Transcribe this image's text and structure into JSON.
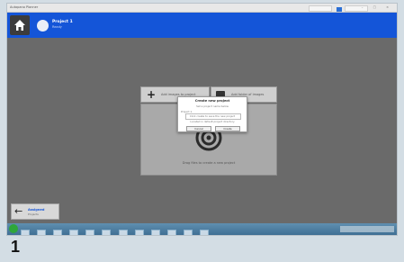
{
  "window": {
    "title": "Autopano Planner",
    "controls": "– □ ×"
  },
  "topbar": {
    "project_name": "Project 1",
    "project_status": "Ready"
  },
  "actions": {
    "add_images": "Add images to project",
    "add_folder": "Add folder of images"
  },
  "drop_panel": {
    "label": "Drag files to create a new project"
  },
  "dialog": {
    "title": "Create new project",
    "line1": "Set a project name below",
    "line2": "Project 1",
    "line3": "Click create to save the new project",
    "line4": "Located in default project directory",
    "cancel": "Cancel",
    "create": "Create"
  },
  "back": {
    "label": "Assigned",
    "sub": "Projects"
  },
  "step_number": "1",
  "colors": {
    "topbar": "#1455d8",
    "workspace": "#6a6a6a",
    "panel": "#a9a9a9",
    "page_background": "#d3dde4"
  }
}
